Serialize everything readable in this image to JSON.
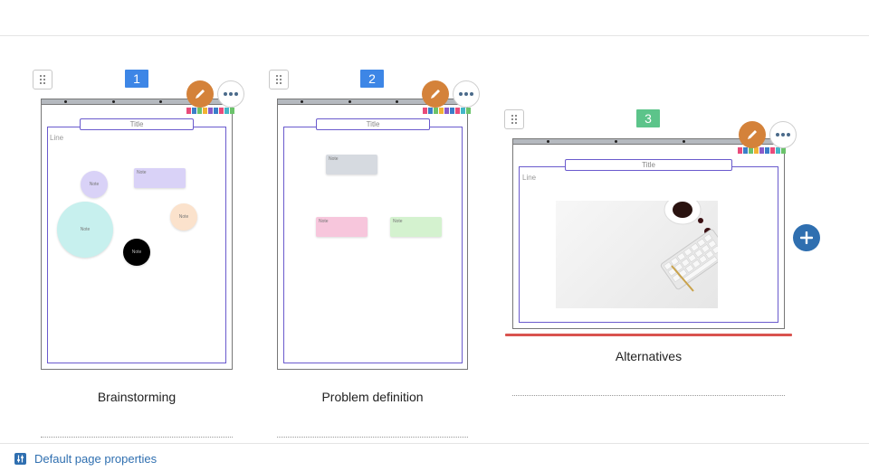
{
  "colors": {
    "page_num_blue": "#3d86e6",
    "page_num_green": "#5cc48a",
    "edit_orange": "#d4823a",
    "active_red": "#d9534f",
    "link_blue": "#2f6fb0",
    "frame_purple": "#6a5acd"
  },
  "icons": {
    "drag": "drag-handle-icon",
    "edit": "pencil-icon",
    "more": "more-dots-icon",
    "add": "plus-icon",
    "properties": "sliders-icon"
  },
  "pages": [
    {
      "number": "1",
      "caption": "Brainstorming",
      "title": "Title",
      "line_label": "Line",
      "notes": [
        "Note",
        "Note",
        "Note",
        "Note",
        "Note"
      ]
    },
    {
      "number": "2",
      "caption": "Problem definition",
      "title": "Title",
      "notes": [
        "Note",
        "Note",
        "Note"
      ]
    },
    {
      "number": "3",
      "caption": "Alternatives",
      "title": "Title",
      "line_label": "Line",
      "active": true
    }
  ],
  "footer": {
    "properties_label": "Default page properties"
  }
}
